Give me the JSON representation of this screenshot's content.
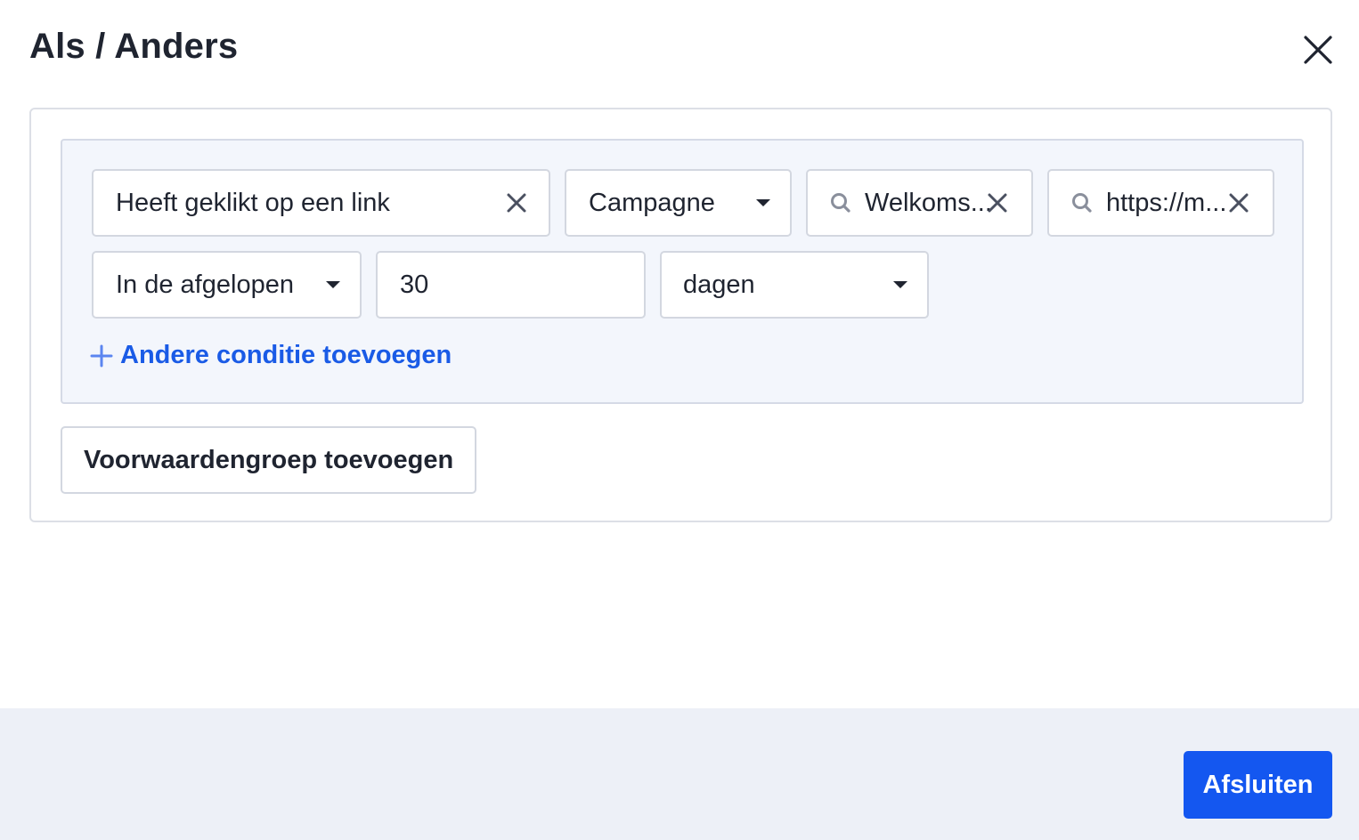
{
  "modal": {
    "title": "Als / Anders"
  },
  "condition": {
    "action": "Heeft geklikt op een link",
    "type_select": "Campagne",
    "campaign_search": "Welkoms...",
    "link_search": "https://m...",
    "time_operator": "In de afgelopen",
    "amount": "30",
    "unit": "dagen"
  },
  "actions": {
    "add_condition": "Andere conditie toevoegen",
    "add_group": "Voorwaardengroep toevoegen"
  },
  "footer": {
    "close_label": "Afsluiten"
  },
  "icons": {
    "close": "close-icon",
    "clear": "clear-icon",
    "search": "search-icon",
    "caret": "chevron-down-icon",
    "plus": "plus-icon"
  },
  "colors": {
    "accent": "#1457f0",
    "link": "#1a5be6",
    "group_bg": "#f3f6fc",
    "footer_bg": "#edf0f7"
  }
}
